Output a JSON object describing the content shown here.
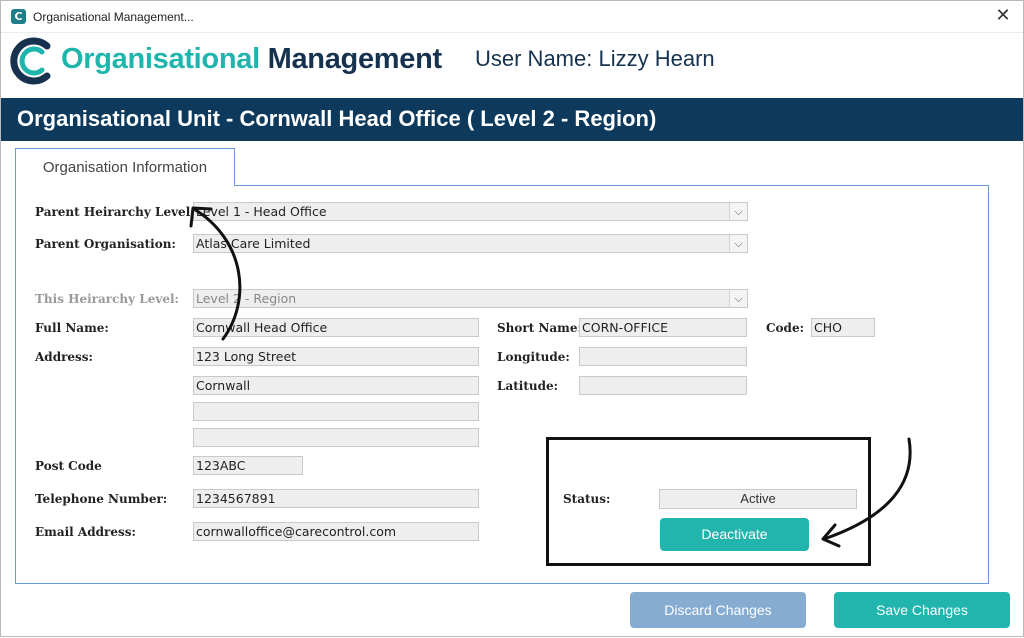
{
  "window": {
    "title": "Organisational Management...",
    "close_label": "✕"
  },
  "header": {
    "logo_part1": "Organisational",
    "logo_part2": "Management",
    "user_name": "User Name: Lizzy Hearn"
  },
  "banner": {
    "title": "Organisational Unit - Cornwall Head Office ( Level 2 - Region)"
  },
  "tab": {
    "label": "Organisation Information"
  },
  "form": {
    "parent_hierarchy_level": {
      "label": "Parent Heirarchy Level:",
      "value": "Level 1 - Head Office"
    },
    "parent_organisation": {
      "label": "Parent Organisation:",
      "value": "Atlas Care Limited"
    },
    "this_hierarchy_level": {
      "label": "This Heirarchy Level:",
      "value": "Level 2 - Region"
    },
    "full_name": {
      "label": "Full Name:",
      "value": "Cornwall Head Office"
    },
    "short_name": {
      "label": "Short Name:",
      "value": "CORN-OFFICE"
    },
    "code": {
      "label": "Code:",
      "value": "CHO"
    },
    "address": {
      "label": "Address:",
      "line1": "123 Long Street",
      "line2": "Cornwall",
      "line3": "",
      "line4": ""
    },
    "longitude": {
      "label": "Longitude:",
      "value": ""
    },
    "latitude": {
      "label": "Latitude:",
      "value": ""
    },
    "post_code": {
      "label": "Post Code",
      "value": "123ABC"
    },
    "telephone": {
      "label": "Telephone Number:",
      "value": "1234567891"
    },
    "email": {
      "label": "Email Address:",
      "value": "cornwalloffice@carecontrol.com"
    },
    "status": {
      "label": "Status:",
      "value": "Active"
    },
    "deactivate_label": "Deactivate"
  },
  "footer": {
    "discard_label": "Discard Changes",
    "save_label": "Save Changes"
  },
  "colors": {
    "brand_teal": "#22b5ad",
    "brand_navy": "#0d3a5c",
    "discard_blue": "#87acd1"
  }
}
